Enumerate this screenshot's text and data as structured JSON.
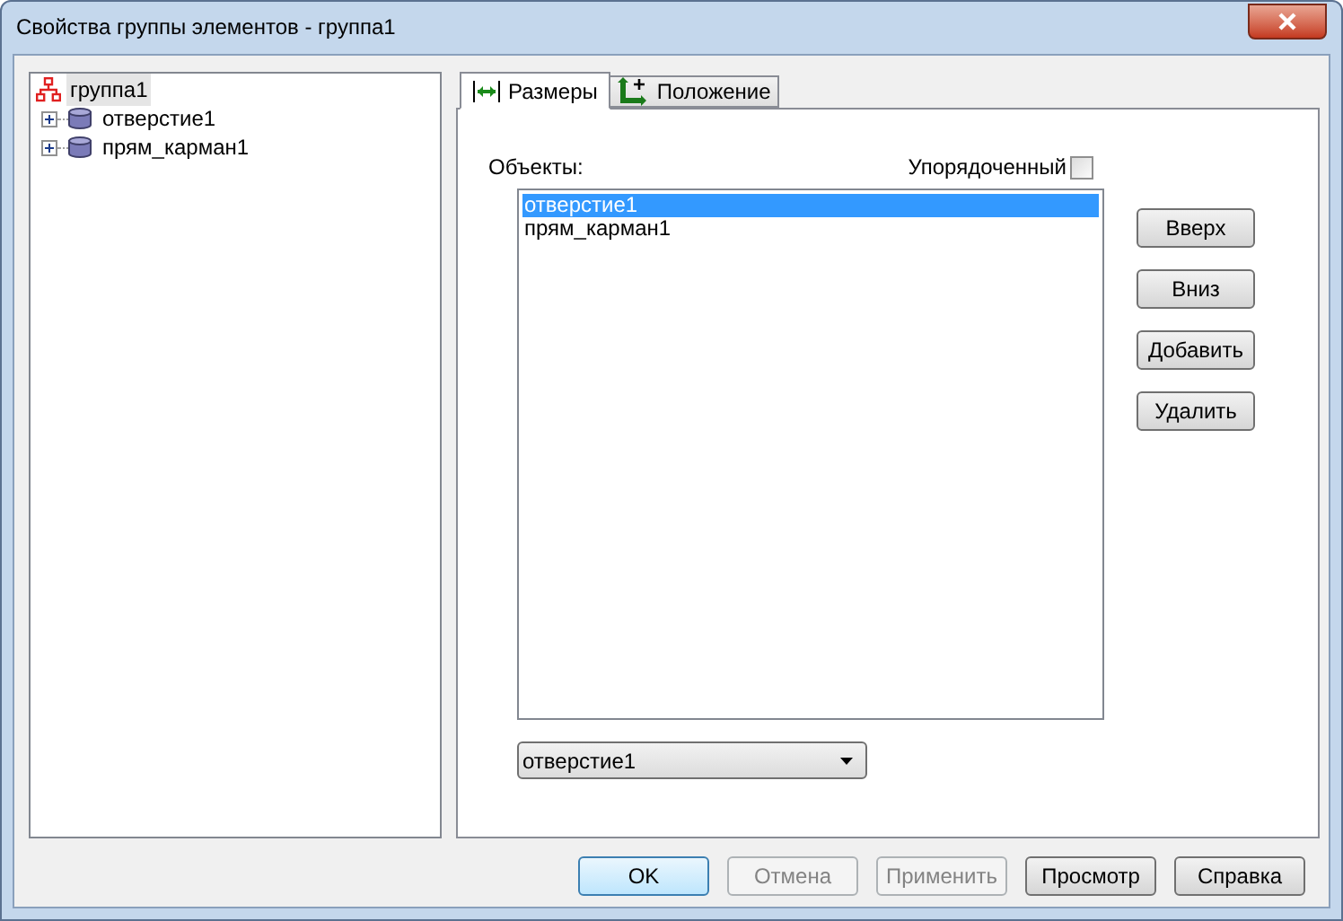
{
  "window": {
    "title": "Свойства группы элементов - группа1"
  },
  "tree": {
    "label": "группа1",
    "selected": true,
    "children": [
      {
        "label": "отверстие1",
        "expanded": false
      },
      {
        "label": "прям_карман1",
        "expanded": false
      }
    ]
  },
  "tabs": [
    {
      "label": "Размеры",
      "kind": "size",
      "selected": true
    },
    {
      "label": "Положение",
      "kind": "position",
      "selected": false
    }
  ],
  "objects_label": "Объекты:",
  "ordered": {
    "label": "Упорядоченный",
    "checked": false
  },
  "objects": [
    {
      "label": "отверстие1",
      "selected": true
    },
    {
      "label": "прям_карман1",
      "selected": false
    }
  ],
  "side_buttons": [
    "Вверх",
    "Вниз",
    "Добавить",
    "Удалить"
  ],
  "dropdown": {
    "value": "отверстие1"
  },
  "buttons": [
    {
      "label": "OK",
      "default": true,
      "disabled": false
    },
    {
      "label": "Отмена",
      "default": false,
      "disabled": true
    },
    {
      "label": "Применить",
      "default": false,
      "disabled": true
    },
    {
      "label": "Просмотр",
      "default": false,
      "disabled": false
    },
    {
      "label": "Справка",
      "default": false,
      "disabled": false
    }
  ]
}
